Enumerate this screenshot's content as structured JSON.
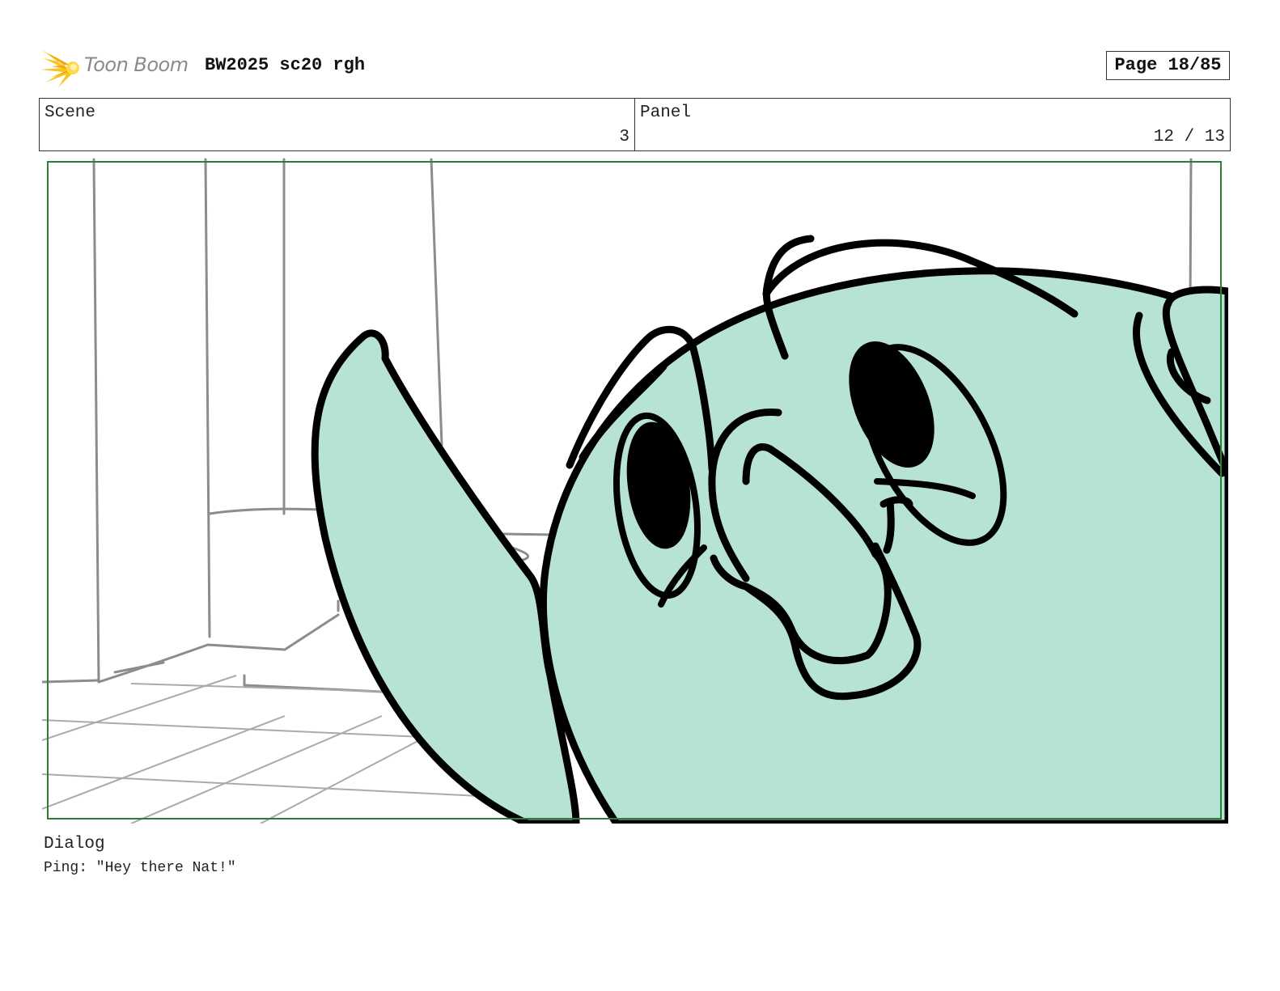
{
  "header": {
    "brand": "Toon Boom",
    "title": "BW2025 sc20 rgh",
    "page_label": "Page 18/85"
  },
  "info": {
    "scene_label": "Scene",
    "scene_value": "3",
    "panel_label": "Panel",
    "panel_value": "12 / 13"
  },
  "dialog": {
    "label": "Dialog",
    "text": "Ping: \"Hey there Nat!\""
  },
  "colors": {
    "character_fill": "#b7e3d5",
    "frame_border": "#2e7d32",
    "logo_flare": "#f5c518"
  }
}
